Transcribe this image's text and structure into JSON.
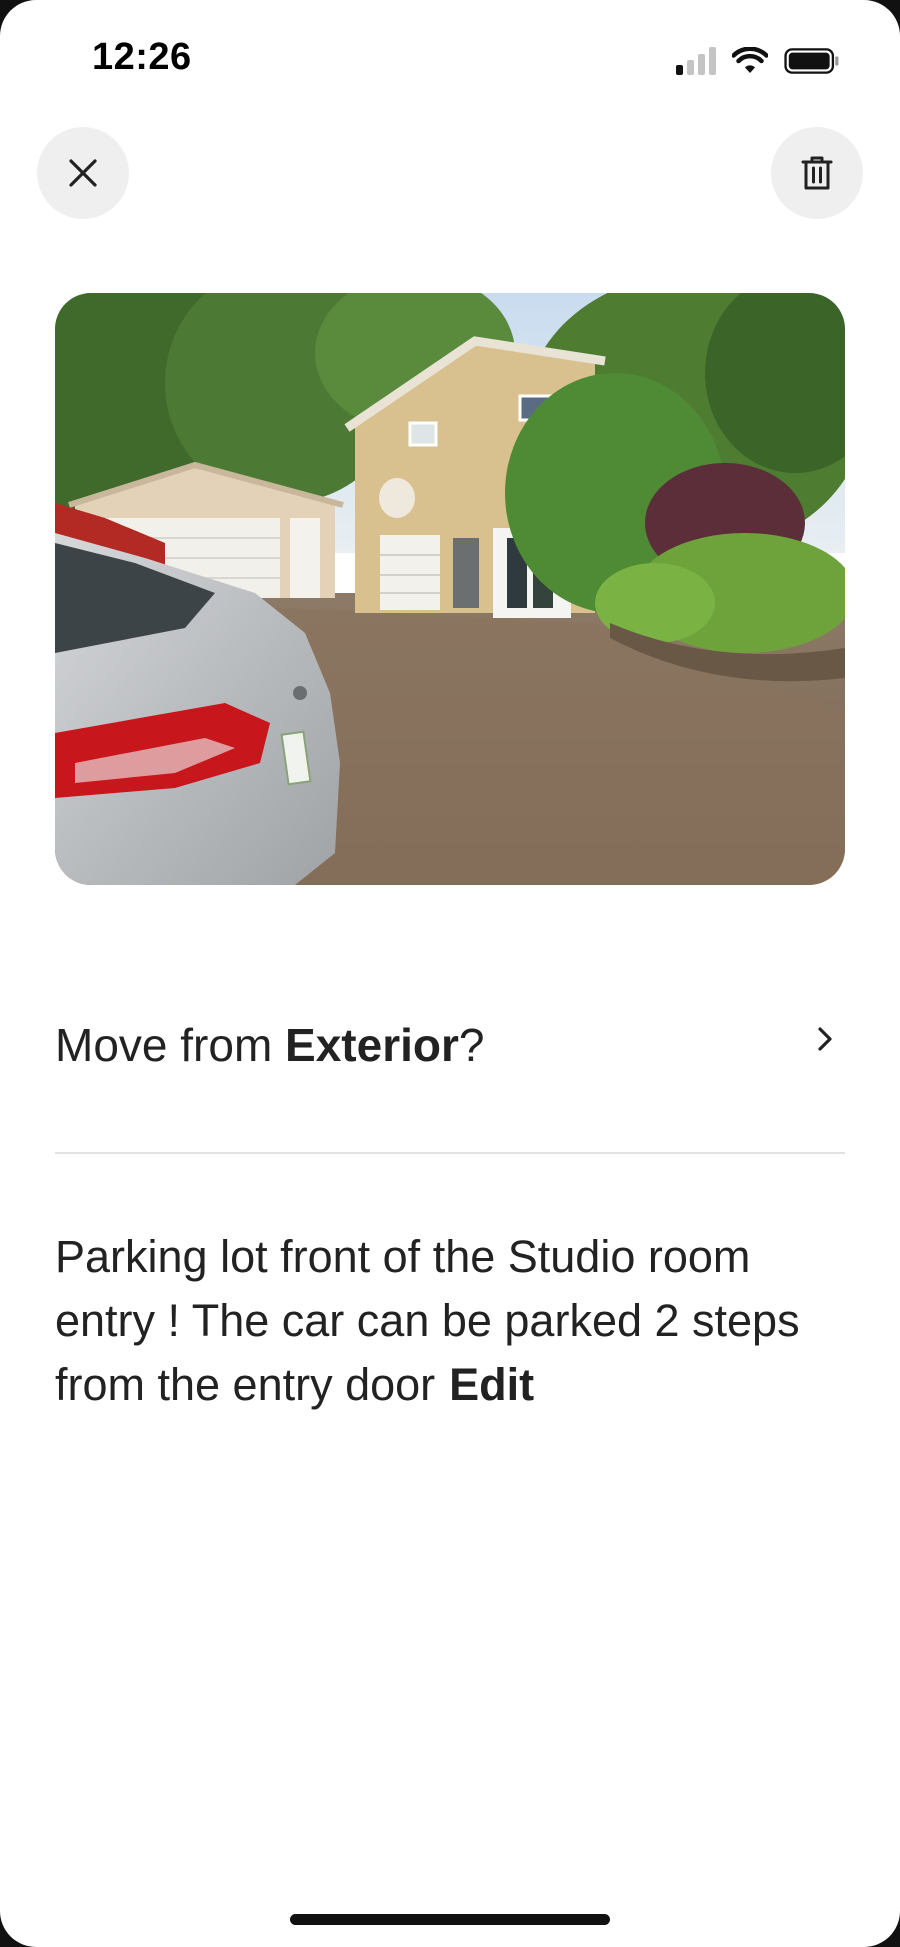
{
  "status_bar": {
    "time": "12:26",
    "signal_bars_active": 1,
    "signal_bars_total": 4,
    "battery_level": 0.9
  },
  "header": {
    "close_icon": "close-icon",
    "delete_icon": "trash-icon"
  },
  "photo": {
    "subject": "house-driveway-photo"
  },
  "move": {
    "prefix": "Move from ",
    "category": "Exterior",
    "suffix": "?",
    "chevron_icon": "chevron-right-icon"
  },
  "caption": {
    "text": "Parking lot front of the Studio room entry ! The car can be parked 2 steps from the entry door",
    "edit_label": "Edit"
  },
  "colors": {
    "background": "#ffffff",
    "text": "#222222",
    "button_bg": "#efefef",
    "divider": "#e2e2e2"
  }
}
